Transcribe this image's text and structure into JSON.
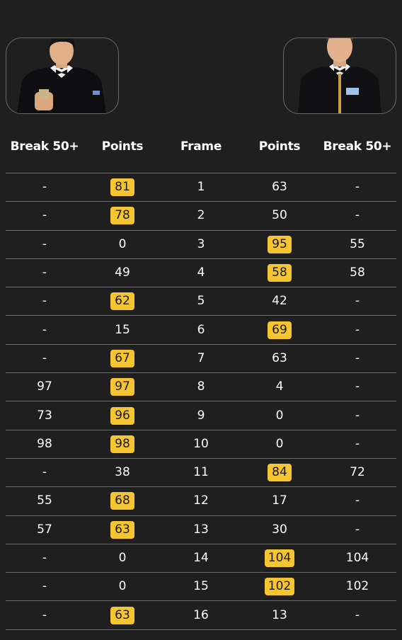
{
  "colors": {
    "background": "#1f1f1f",
    "highlight": "#f5c431",
    "divider": "#6c6c6c"
  },
  "players": [
    {
      "photo": "player-1-photo"
    },
    {
      "photo": "player-2-photo"
    }
  ],
  "headers": {
    "break_left": "Break 50+",
    "points_left": "Points",
    "frame": "Frame",
    "points_right": "Points",
    "break_right": "Break 50+"
  },
  "frames": [
    {
      "frame": "1",
      "break_left": "-",
      "points_left": "81",
      "points_right": "63",
      "break_right": "-",
      "winner": "left"
    },
    {
      "frame": "2",
      "break_left": "-",
      "points_left": "78",
      "points_right": "50",
      "break_right": "-",
      "winner": "left"
    },
    {
      "frame": "3",
      "break_left": "-",
      "points_left": "0",
      "points_right": "95",
      "break_right": "55",
      "winner": "right"
    },
    {
      "frame": "4",
      "break_left": "-",
      "points_left": "49",
      "points_right": "58",
      "break_right": "58",
      "winner": "right"
    },
    {
      "frame": "5",
      "break_left": "-",
      "points_left": "62",
      "points_right": "42",
      "break_right": "-",
      "winner": "left"
    },
    {
      "frame": "6",
      "break_left": "-",
      "points_left": "15",
      "points_right": "69",
      "break_right": "-",
      "winner": "right"
    },
    {
      "frame": "7",
      "break_left": "-",
      "points_left": "67",
      "points_right": "63",
      "break_right": "-",
      "winner": "left"
    },
    {
      "frame": "8",
      "break_left": "97",
      "points_left": "97",
      "points_right": "4",
      "break_right": "-",
      "winner": "left"
    },
    {
      "frame": "9",
      "break_left": "73",
      "points_left": "96",
      "points_right": "0",
      "break_right": "-",
      "winner": "left"
    },
    {
      "frame": "10",
      "break_left": "98",
      "points_left": "98",
      "points_right": "0",
      "break_right": "-",
      "winner": "left"
    },
    {
      "frame": "11",
      "break_left": "-",
      "points_left": "38",
      "points_right": "84",
      "break_right": "72",
      "winner": "right"
    },
    {
      "frame": "12",
      "break_left": "55",
      "points_left": "68",
      "points_right": "17",
      "break_right": "-",
      "winner": "left"
    },
    {
      "frame": "13",
      "break_left": "57",
      "points_left": "63",
      "points_right": "30",
      "break_right": "-",
      "winner": "left"
    },
    {
      "frame": "14",
      "break_left": "-",
      "points_left": "0",
      "points_right": "104",
      "break_right": "104",
      "winner": "right"
    },
    {
      "frame": "15",
      "break_left": "-",
      "points_left": "0",
      "points_right": "102",
      "break_right": "102",
      "winner": "right"
    },
    {
      "frame": "16",
      "break_left": "-",
      "points_left": "63",
      "points_right": "13",
      "break_right": "-",
      "winner": "left"
    }
  ]
}
